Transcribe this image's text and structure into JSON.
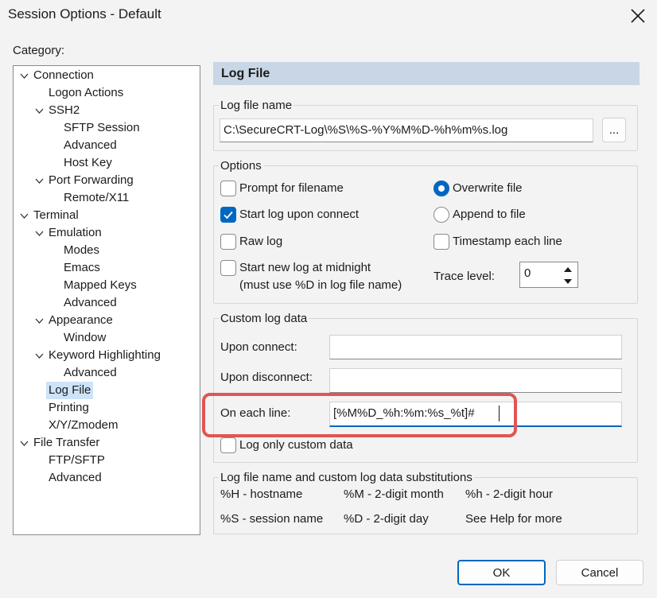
{
  "window": {
    "title": "Session Options - Default"
  },
  "category": {
    "label": "Category:",
    "tree": [
      {
        "label": "Connection",
        "expanded": true
      },
      {
        "label": "Logon Actions"
      },
      {
        "label": "SSH2",
        "expanded": true
      },
      {
        "label": "SFTP Session"
      },
      {
        "label": "Advanced"
      },
      {
        "label": "Host Key"
      },
      {
        "label": "Port Forwarding",
        "expanded": true
      },
      {
        "label": "Remote/X11"
      },
      {
        "label": "Terminal",
        "expanded": true
      },
      {
        "label": "Emulation",
        "expanded": true
      },
      {
        "label": "Modes"
      },
      {
        "label": "Emacs"
      },
      {
        "label": "Mapped Keys"
      },
      {
        "label": "Advanced"
      },
      {
        "label": "Appearance",
        "expanded": true
      },
      {
        "label": "Window"
      },
      {
        "label": "Keyword Highlighting",
        "expanded": true
      },
      {
        "label": "Advanced"
      },
      {
        "label": "Log File",
        "selected": true
      },
      {
        "label": "Printing"
      },
      {
        "label": "X/Y/Zmodem"
      },
      {
        "label": "File Transfer",
        "expanded": true
      },
      {
        "label": "FTP/SFTP"
      },
      {
        "label": "Advanced"
      }
    ]
  },
  "panel": {
    "header": "Log File",
    "log_file_name": {
      "group_title": "Log file name",
      "value": "C:\\SecureCRT-Log\\%S\\%S-%Y%M%D-%h%m%s.log",
      "browse_label": "..."
    },
    "options": {
      "group_title": "Options",
      "prompt_for_filename": {
        "label": "Prompt for filename",
        "checked": false
      },
      "start_log_upon_connect": {
        "label": "Start log upon connect",
        "checked": true
      },
      "raw_log": {
        "label": "Raw log",
        "checked": false
      },
      "start_new_log_at_midnight": {
        "label": "Start new log at midnight",
        "sublabel": "(must use %D in log file name)",
        "checked": false
      },
      "overwrite_file": {
        "label": "Overwrite file",
        "selected": true
      },
      "append_to_file": {
        "label": "Append to file",
        "selected": false
      },
      "timestamp_each_line": {
        "label": "Timestamp each line",
        "checked": false
      },
      "trace_level": {
        "label": "Trace level:",
        "value": "0"
      }
    },
    "custom_log_data": {
      "group_title": "Custom log data",
      "upon_connect": {
        "label": "Upon connect:",
        "value": ""
      },
      "upon_disconnect": {
        "label": "Upon disconnect:",
        "value": ""
      },
      "on_each_line": {
        "label": "On each line:",
        "value": "[%M%D_%h:%m:%s_%t]#"
      },
      "log_only_custom_data": {
        "label": "Log only custom data",
        "checked": false
      }
    },
    "substitutions": {
      "group_title": "Log file name and custom log data substitutions",
      "rows": [
        [
          "%H - hostname",
          "%M - 2-digit month",
          "%h - 2-digit hour"
        ],
        [
          "%S - session name",
          "%D - 2-digit day",
          "See Help for more"
        ]
      ]
    }
  },
  "buttons": {
    "ok": "OK",
    "cancel": "Cancel"
  },
  "colors": {
    "accent": "#0067c0",
    "header_bg": "#c8d6e5",
    "selection_bg": "#cde3f7",
    "highlight_border": "#e05555"
  }
}
